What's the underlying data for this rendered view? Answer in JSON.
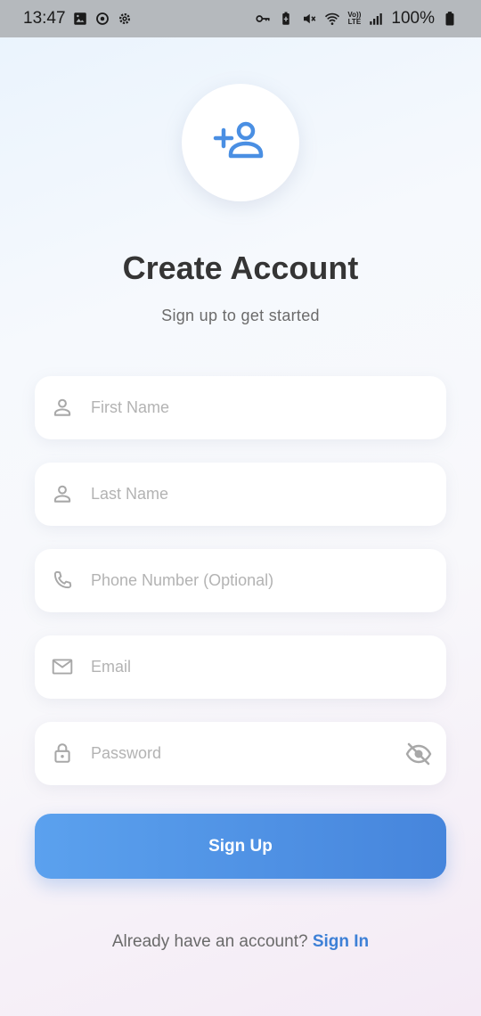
{
  "status_bar": {
    "time": "13:47",
    "battery": "100%",
    "left_icons": [
      "image-icon",
      "sync-icon",
      "settings-icon"
    ],
    "right_icons": [
      "vpn-key-icon",
      "battery-saver-icon",
      "muted-icon",
      "wifi-icon",
      "volte-icon",
      "signal-icon",
      "battery-icon"
    ],
    "volte_top": "Vo))",
    "volte_bottom": "LTE"
  },
  "header": {
    "avatar_icon": "person-add-icon",
    "title": "Create Account",
    "subtitle": "Sign up to get started"
  },
  "form": {
    "first_name": {
      "placeholder": "First Name",
      "value": "",
      "icon": "person-icon"
    },
    "last_name": {
      "placeholder": "Last Name",
      "value": "",
      "icon": "person-icon"
    },
    "phone": {
      "placeholder": "Phone Number (Optional)",
      "value": "",
      "icon": "phone-icon"
    },
    "email": {
      "placeholder": "Email",
      "value": "",
      "icon": "mail-icon"
    },
    "password": {
      "placeholder": "Password",
      "value": "",
      "icon": "lock-icon",
      "toggle_icon": "visibility-off-icon"
    }
  },
  "actions": {
    "signup_label": "Sign Up"
  },
  "footer": {
    "prompt": "Already have an account?",
    "link": "Sign In"
  },
  "colors": {
    "accent": "#4a8fe3",
    "title": "#353535",
    "placeholder": "#b3b3b3",
    "icon_gray": "#a8a8a8",
    "link": "#3d80d6"
  }
}
